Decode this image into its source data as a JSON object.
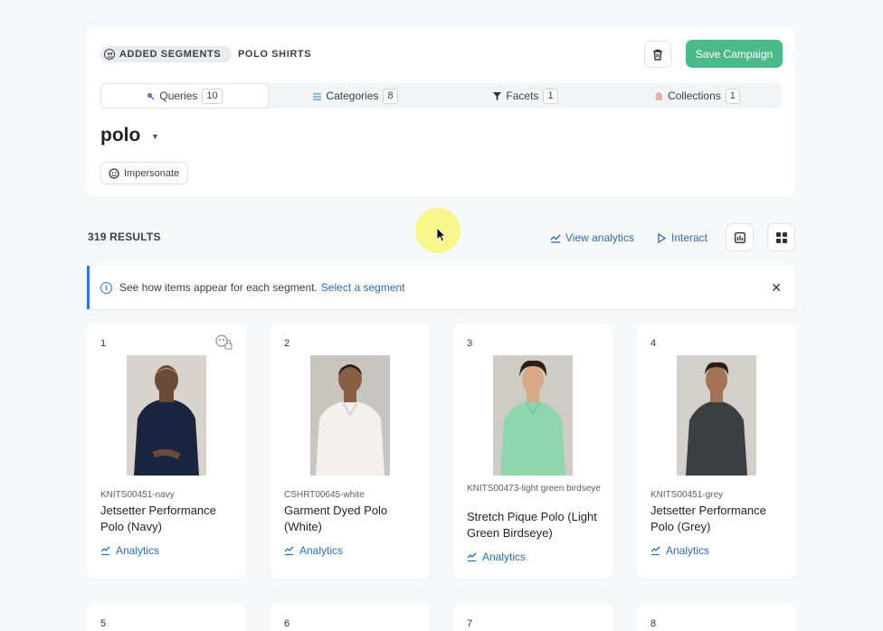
{
  "header": {
    "segments_label": "ADDED SEGMENTS",
    "segment_name": "POLO SHIRTS",
    "save_label": "Save Campaign"
  },
  "tabs": [
    {
      "label": "Queries",
      "count": "10"
    },
    {
      "label": "Categories",
      "count": "8"
    },
    {
      "label": "Facets",
      "count": "1"
    },
    {
      "label": "Collections",
      "count": "1"
    }
  ],
  "query": {
    "title": "polo",
    "impersonate_label": "Impersonate"
  },
  "results": {
    "count_label": "319 RESULTS",
    "view_analytics_label": "View analytics",
    "interact_label": "Interact"
  },
  "banner": {
    "text": "See how items appear for each segment.",
    "link": "Select a segment"
  },
  "products": [
    {
      "rank": "1",
      "sku": "KNITS00451-navy",
      "name": "Jetsetter Performance Polo (Navy)",
      "analytics": "Analytics",
      "shirt_color": "#1b2540",
      "bg": "#d9d4cd",
      "skin": "#6b4a3a",
      "hair": "#bdb8b0"
    },
    {
      "rank": "2",
      "sku": "CSHRT00645-white",
      "name": "Garment Dyed Polo (White)",
      "analytics": "Analytics",
      "shirt_color": "#f2f1ee",
      "bg": "#c9c6c1",
      "skin": "#8a5e44",
      "hair": "#2a211c"
    },
    {
      "rank": "3",
      "sku": "KNITS00473-light green birdseye",
      "name": "Stretch Pique Polo (Light Green Birdseye)",
      "analytics": "Analytics",
      "shirt_color": "#8fd6b0",
      "bg": "#cfcbc5",
      "skin": "#d9a888",
      "hair": "#2b1e17"
    },
    {
      "rank": "4",
      "sku": "KNITS00451-grey",
      "name": "Jetsetter Performance Polo (Grey)",
      "analytics": "Analytics",
      "shirt_color": "#3c3f42",
      "bg": "#d3d0cb",
      "skin": "#a47256",
      "hair": "#2b1e17"
    }
  ],
  "next_row_ranks": [
    "5",
    "6",
    "7",
    "8"
  ],
  "colors": {
    "accent_green": "#4cb98b",
    "link_blue": "#2b6cb0",
    "info_blue": "#2b78c6"
  }
}
